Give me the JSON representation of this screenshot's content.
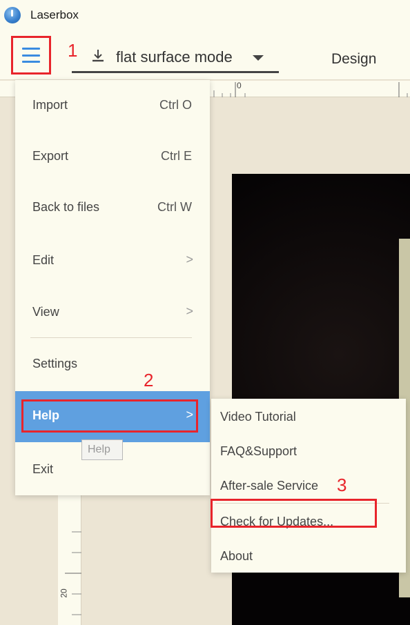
{
  "app": {
    "title": "Laserbox"
  },
  "toolbar": {
    "mode_label": "flat surface mode",
    "design_tab": "Design"
  },
  "annotations": {
    "step1": "1",
    "step2": "2",
    "step3": "3"
  },
  "ruler": {
    "top_zero": "0",
    "left_mark": "20"
  },
  "menu": {
    "items": [
      {
        "label": "Import",
        "shortcut": "Ctrl O"
      },
      {
        "label": "Export",
        "shortcut": "Ctrl E"
      },
      {
        "label": "Back to files",
        "shortcut": "Ctrl W"
      },
      {
        "label": "Edit",
        "chevron": ">"
      },
      {
        "label": "View",
        "chevron": ">"
      },
      {
        "label": "Settings"
      },
      {
        "label": "Help",
        "chevron": ">"
      },
      {
        "label": "Exit"
      }
    ]
  },
  "tooltip": {
    "text": "Help"
  },
  "help_submenu": {
    "items": [
      {
        "label": "Video Tutorial"
      },
      {
        "label": "FAQ&Support"
      },
      {
        "label": "After-sale Service"
      },
      {
        "label": "Check for Updates..."
      },
      {
        "label": "About"
      }
    ]
  },
  "colors": {
    "accent_blue": "#5fa0e0",
    "annotation_red": "#e8242b",
    "menu_bg": "#fcfbee",
    "workspace_bg": "#ece5d4"
  },
  "icons": [
    "app-logo-icon",
    "hamburger-menu-icon",
    "download-icon",
    "caret-down-icon",
    "chevron-right-icon"
  ]
}
